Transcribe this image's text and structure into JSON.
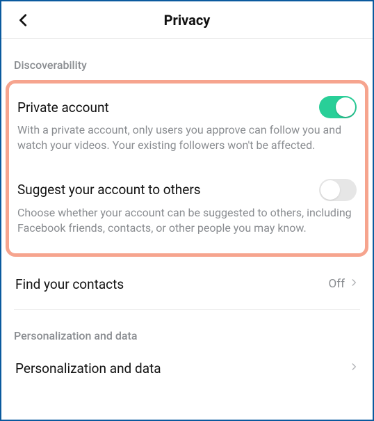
{
  "header": {
    "title": "Privacy"
  },
  "sections": {
    "discoverability": {
      "label": "Discoverability",
      "privateAccount": {
        "title": "Private account",
        "desc": "With a private account, only users you approve can follow you and watch your videos. Your existing followers won't be affected.",
        "enabled": true
      },
      "suggest": {
        "title": "Suggest your account to others",
        "desc": "Choose whether your account can be suggested to others, including Facebook friends, contacts, or other people you may know.",
        "enabled": false
      },
      "findContacts": {
        "title": "Find your contacts",
        "value": "Off"
      }
    },
    "personalization": {
      "label": "Personalization and data",
      "item": {
        "title": "Personalization and data"
      }
    }
  }
}
